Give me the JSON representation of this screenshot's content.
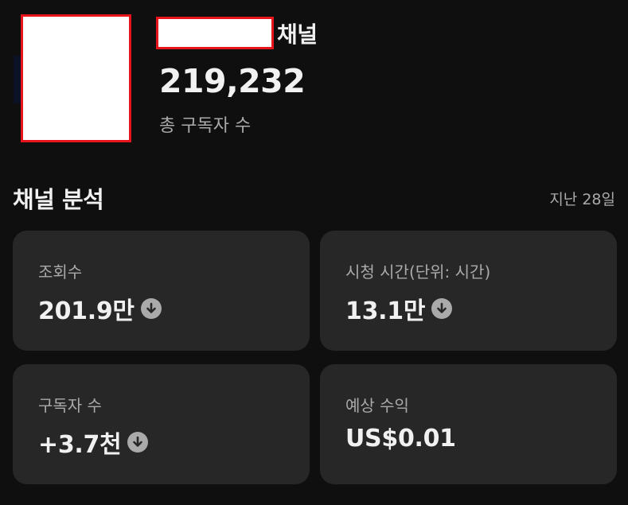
{
  "channel": {
    "name_suffix": "채널",
    "subscriber_count": "219,232",
    "subscriber_label": "총 구독자 수"
  },
  "analytics": {
    "title": "채널 분석",
    "period": "지난 28일",
    "cards": [
      {
        "label": "조회수",
        "value": "201.9만",
        "trend_icon": "arrow-down-circle-icon"
      },
      {
        "label": "시청 시간(단위: 시간)",
        "value": "13.1만",
        "trend_icon": "arrow-down-circle-icon"
      },
      {
        "label": "구독자 수",
        "value": "+3.7천",
        "trend_icon": "arrow-down-circle-icon"
      },
      {
        "label": "예상 수익",
        "value": "US$0.01"
      }
    ]
  }
}
